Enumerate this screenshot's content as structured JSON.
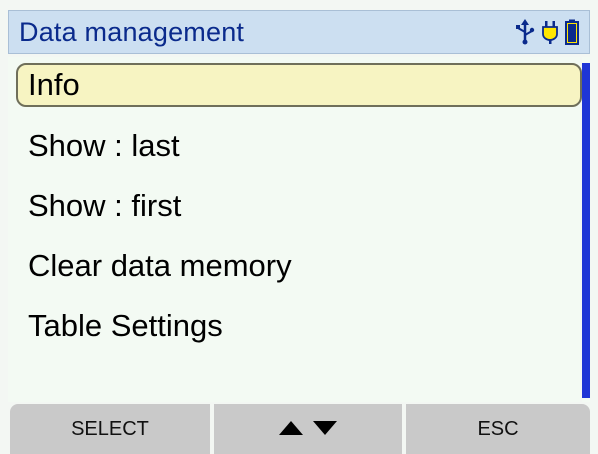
{
  "header": {
    "title": "Data management",
    "icons": [
      "usb-icon",
      "power-plug-icon",
      "battery-icon"
    ],
    "accent_color": "#0a2a8c",
    "background_color": "#ccdff1"
  },
  "menu": {
    "items": [
      {
        "label": "Info",
        "selected": true
      },
      {
        "label": "Show : last",
        "selected": false
      },
      {
        "label": "Show : first",
        "selected": false
      },
      {
        "label": "Clear data memory",
        "selected": false
      },
      {
        "label": "Table Settings",
        "selected": false
      }
    ],
    "selected_color": "#f7f4c2"
  },
  "softkeys": {
    "left_label": "SELECT",
    "middle_icons": [
      "up-arrow-icon",
      "down-arrow-icon"
    ],
    "right_label": "ESC",
    "color": "#c9c9c9"
  },
  "scrollbar": {
    "color": "#1f35d6"
  }
}
